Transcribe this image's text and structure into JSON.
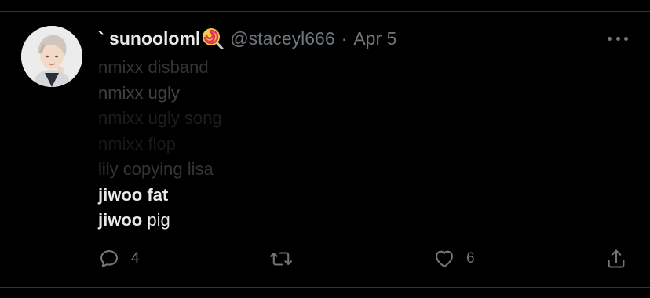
{
  "tweet": {
    "display_name": "` sunooloml",
    "name_emoji": "lollipop-emoji",
    "handle": "@staceyl666",
    "separator": "·",
    "date": "Apr 5",
    "lines": [
      {
        "text": "nmixx disband",
        "opacity": 0.22,
        "weight": "normal"
      },
      {
        "text": "nmixx ugly",
        "opacity": 0.28,
        "weight": "normal"
      },
      {
        "text": "nmixx ugly song",
        "opacity": 0.12,
        "weight": "normal"
      },
      {
        "text": "nmixx flop",
        "opacity": 0.1,
        "weight": "normal"
      },
      {
        "text": "lily copying lisa",
        "opacity": 0.22,
        "weight": "normal"
      },
      {
        "bold": "jiwoo fat",
        "rest": ""
      },
      {
        "bold": "jiwoo",
        "rest": " pig"
      }
    ],
    "reply_count": "4",
    "retweet_count": "",
    "like_count": "6",
    "colors": {
      "background": "#000000",
      "text": "#e7e9ea",
      "muted": "#71767b",
      "divider": "#2f3336"
    }
  }
}
